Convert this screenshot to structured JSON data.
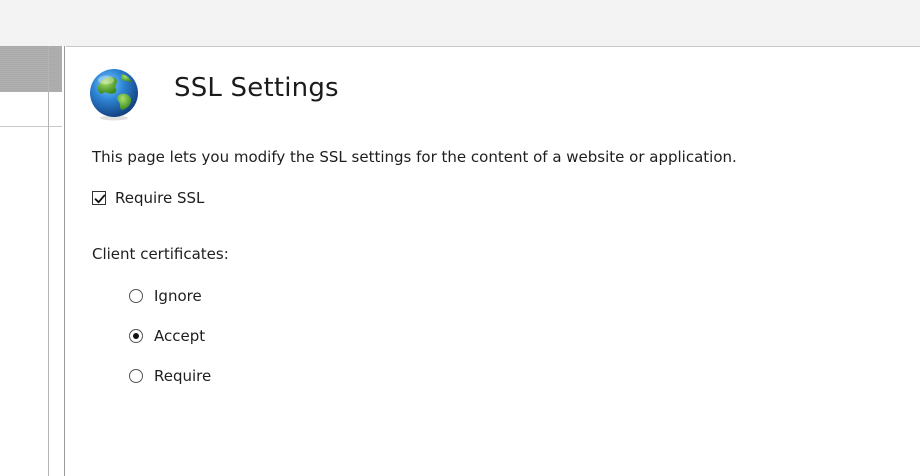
{
  "page": {
    "title": "SSL Settings",
    "description": "This page lets you modify the SSL settings for the content of a website or application.",
    "icon": "globe-icon"
  },
  "require_ssl": {
    "label": "Require SSL",
    "checked": true
  },
  "client_certificates": {
    "label": "Client certificates:",
    "options": [
      {
        "label": "Ignore",
        "selected": false
      },
      {
        "label": "Accept",
        "selected": true
      },
      {
        "label": "Require",
        "selected": false
      }
    ]
  },
  "colors": {
    "background": "#ffffff",
    "top_strip": "#f3f3f3",
    "left_header": "#aaaaaa",
    "pane_border": "#9a9a9a"
  }
}
